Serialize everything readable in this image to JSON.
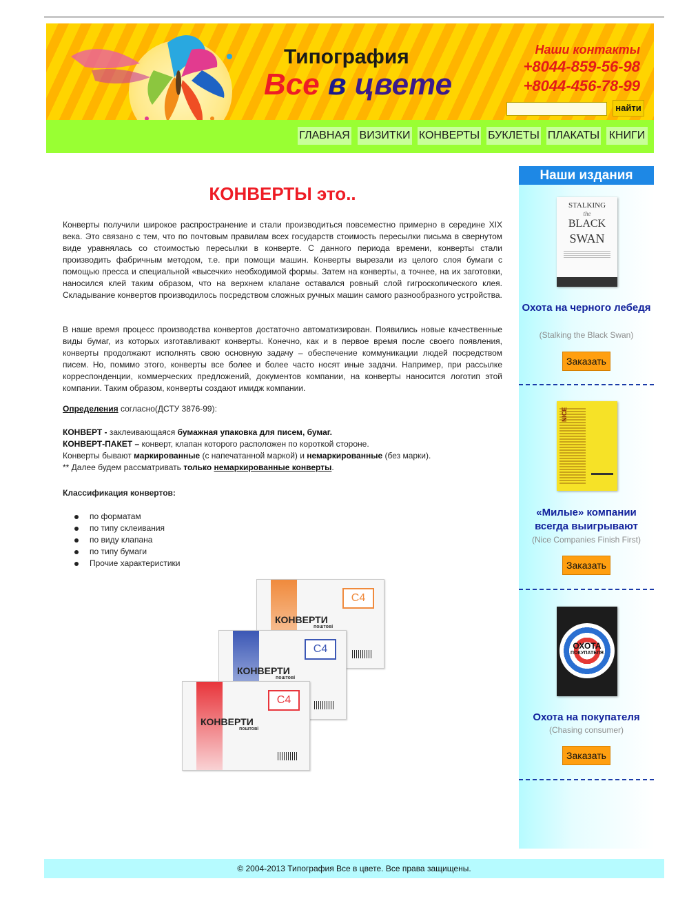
{
  "header": {
    "brand_line1": "Типография",
    "brand_word1": "Все",
    "brand_word2": "в",
    "brand_word3": "цвете",
    "contacts_title": "Наши контакты",
    "phone1": "+8044-859-56-98",
    "phone2": "+8044-456-78-99",
    "search_button": "найти",
    "search_value": ""
  },
  "nav": [
    "ГЛАВНАЯ",
    "ВИЗИТКИ",
    "КОНВЕРТЫ",
    "БУКЛЕТЫ",
    "ПЛАКАТЫ",
    "КНИГИ"
  ],
  "main": {
    "title": "КОНВЕРТЫ это..",
    "para1": "Конверты получили широкое распространение и стали производиться повсеместно примерно в середине XIX века. Это связано с тем, что по почтовым правилам всех государств стоимость пересылки письма в свернутом виде уравнялась со стоимостью пересылки в конверте. С данного периода времени, конверты стали производить фабричным методом, т.е. при помощи машин. Конверты вырезали из целого слоя бумаги с помощью пресса и специальной «высечки» необходимой формы. Затем на конверты, а точнее, на их заготовки, наносился клей таким образом, что на верхнем клапане оставался ровный слой гигроскопического клея. Складывание конвертов производилось посредством сложных ручных машин самого разнообразного устройства.",
    "para2": "В наше время процесс производства конвертов достаточно автоматизирован. Появились новые качественные виды бумаг, из которых изготавливают конверты. Конечно, как и в первое время после своего появления, конверты продолжают исполнять свою основную задачу – обеспечение коммуникации людей посредством писем. Но, помимо этого, конверты все более и более часто носят иные задачи. Например, при рассылке корреспонденции, коммерческих предложений, документов компании, на конверты наносится логотип этой компании. Таким образом, конверты создают имидж компании.",
    "defs_link": "Определения",
    "defs_rest": " согласно(ДСТУ 3876-99):",
    "def1_term": "КОНВЕРТ - ",
    "def1_a": "заклеивающаяся ",
    "def1_b": "бумажная упаковка для писем, бумаг.",
    "def2_term": "КОНВЕРТ-ПАКЕТ – ",
    "def2_rest": "конверт, клапан которого расположен по короткой стороне.",
    "def3_a": "Конверты бывают ",
    "def3_b": "маркированные",
    "def3_c": " (с напечатанной маркой) и ",
    "def3_d": "немаркированные",
    "def3_e": " (без марки).",
    "def4_a": "** Далее будем рассматривать ",
    "def4_b": "только",
    "def4_c": "немаркированные конверты",
    "def4_d": ".",
    "class_title": "Классификация конвертов:",
    "bullets": [
      "по форматам",
      "по типу склеивания",
      "по виду клапана",
      "по типу бумаги",
      "Прочие характеристики"
    ],
    "envelope": {
      "format": "C4",
      "title": "КОНВЕРТИ",
      "subtitle": "поштові",
      "colors": [
        "#f08a3c",
        "#3b57b5",
        "#e8353b"
      ]
    }
  },
  "sidebar": {
    "title": "Наши издания",
    "books": [
      {
        "title": "Охота на черного лебедя",
        "subtitle": "(Stalking the Black Swan)",
        "cover_text": [
          "STALKING",
          "the",
          "BLACK",
          "SWAN"
        ],
        "button": "Заказать"
      },
      {
        "title": "«Милые» компании всегда выигрывают",
        "subtitle": "(Nice Companies Finish First)",
        "cover_text": [
          "NICE",
          "COMPANIES",
          "FINISH",
          "FIRST"
        ],
        "button": "Заказать"
      },
      {
        "title": "Охота на покупателя",
        "subtitle": "(Chasing consumer)",
        "cover_text": [
          "ОХОТА",
          "ПОКУПАТЕЛЯ"
        ],
        "button": "Заказать"
      }
    ]
  },
  "footer": "© 2004-2013 Типография Все в цвете. Все права защищены."
}
